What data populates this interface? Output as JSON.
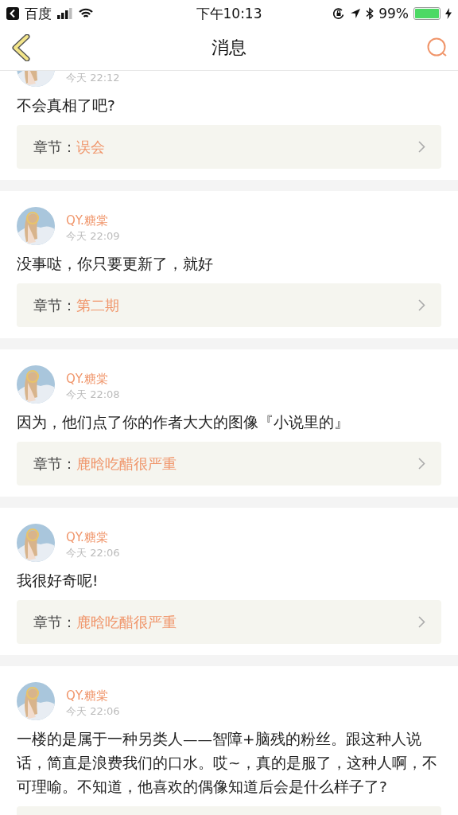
{
  "status_bar": {
    "back_app": "百度",
    "time": "下午10:13",
    "battery_text": "99%"
  },
  "nav": {
    "title": "消息"
  },
  "messages": [
    {
      "time": "今天 22:12",
      "text": "不会真相了吧?",
      "chapter": {
        "label": "章节：",
        "title": "误会"
      }
    },
    {
      "name": "QY.糖棠",
      "time": "今天 22:09",
      "text": "没事哒，你只要更新了，就好",
      "chapter": {
        "label": "章节：",
        "title": "第二期"
      }
    },
    {
      "name": "QY.糖棠",
      "time": "今天 22:08",
      "text": "因为，他们点了你的作者大大的图像『小说里的』",
      "chapter": {
        "label": "章节：",
        "title": "鹿晗吃醋很严重"
      }
    },
    {
      "name": "QY.糖棠",
      "time": "今天 22:06",
      "text": "我很好奇呢!",
      "chapter": {
        "label": "章节：",
        "title": "鹿晗吃醋很严重"
      }
    },
    {
      "name": "QY.糖棠",
      "time": "今天 22:06",
      "text": "一楼的是属于一种另类人——智障+脑残的粉丝。跟这种人说话，简直是浪费我们的口水。哎~，真的是服了，这种人啊，不可理喻。不知道，他喜欢的偶像知道后会是什么样子了?",
      "chapter": {
        "cut_off": true
      }
    }
  ]
}
